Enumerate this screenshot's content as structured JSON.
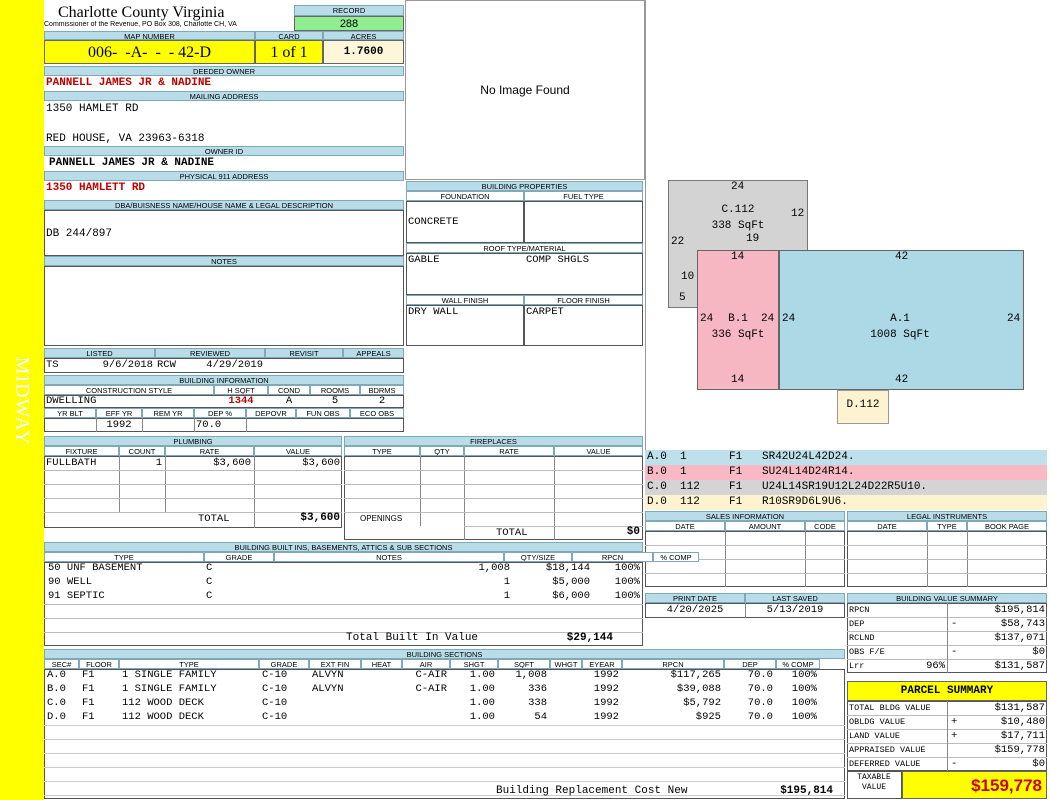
{
  "sidebar": {
    "label": "MIDWAY"
  },
  "header": {
    "county": "Charlotte County Virginia",
    "office": "Commissioner of the Revenue, PO Box 308, Charlotte CH, VA",
    "record_label": "RECORD",
    "record": "288",
    "map_label": "MAP NUMBER",
    "map": "006-  -A-  -  - 42-D",
    "card_label": "CARD",
    "card": "1 of 1",
    "acres_label": "ACRES",
    "acres": "1.7600"
  },
  "owner": {
    "deeded_label": "DEEDED OWNER",
    "deeded": "PANNELL JAMES JR & NADINE",
    "mailing_label": "MAILING ADDRESS",
    "addr1": "1350 HAMLET RD",
    "addr2": "RED HOUSE, VA 23963-6318",
    "ownerid_label": "OWNER ID",
    "ownerid": "PANNELL JAMES JR & NADINE",
    "phys_label": "PHYSICAL 911 ADDRESS",
    "phys": "1350 HAMLETT RD",
    "dba_label": "DBA/BUISNESS NAME/HOUSE NAME & LEGAL DESCRIPTION",
    "dba": "DB 244/897",
    "notes_label": "NOTES"
  },
  "photo": {
    "text": "No Image Found"
  },
  "building_properties": {
    "title": "BUILDING PROPERTIES",
    "foundation_label": "FOUNDATION",
    "fuel_label": "FUEL TYPE",
    "foundation": "CONCRETE",
    "fuel": "",
    "roof_label": "ROOF TYPE/MATERIAL",
    "roof_type": "GABLE",
    "roof_material": "COMP SHGLS",
    "wall_label": "WALL FINISH",
    "floor_label": "FLOOR FINISH",
    "wall": "DRY WALL",
    "floor": "CARPET"
  },
  "listing": {
    "listed_label": "LISTED",
    "reviewed_label": "REVIEWED",
    "revisit_label": "REVISIT",
    "appeals_label": "APPEALS",
    "listed_by": "TS",
    "listed_date": "9/6/2018",
    "reviewed_by": "RCW",
    "reviewed_date": "4/29/2019"
  },
  "building_info": {
    "title": "BUILDING INFORMATION",
    "style_label": "CONSTRUCTION STYLE",
    "hsqft_label": "H SQFT",
    "cond_label": "COND",
    "rooms_label": "ROOMS",
    "bdrms_label": "BDRMS",
    "style": "DWELLING",
    "hsqft": "1344",
    "cond": "A",
    "rooms": "5",
    "bdrms": "2",
    "yrblt_label": "YR BLT",
    "effyr_label": "EFF YR",
    "remyr_label": "REM YR",
    "dep_label": "DEP %",
    "depovr_label": "DEPOVR",
    "funobs_label": "FUN OBS",
    "ecoobs_label": "ECO OBS",
    "effyr": "1992",
    "dep": "70.0"
  },
  "plumbing": {
    "title": "PLUMBING",
    "headers": [
      "FIXTURE",
      "COUNT",
      "RATE",
      "VALUE"
    ],
    "rows": [
      {
        "fixture": "FULLBATH",
        "count": "1",
        "rate": "$3,600",
        "value": "$3,600"
      }
    ],
    "total_label": "TOTAL",
    "total": "$3,600"
  },
  "fireplaces": {
    "title": "FIREPLACES",
    "headers": [
      "TYPE",
      "QTY",
      "RATE",
      "VALUE"
    ],
    "openings_label": "OPENINGS",
    "total_label": "TOTAL",
    "total": "$0"
  },
  "sketch": {
    "areas": [
      {
        "code": "C.112",
        "sqft": "338 SqFt"
      },
      {
        "code": "B.1",
        "sqft": "336 SqFt"
      },
      {
        "code": "A.1",
        "sqft": "1008 SqFt"
      },
      {
        "code": "D.112",
        "sqft": ""
      }
    ],
    "dims": {
      "c_top": "24",
      "c_right": "12",
      "c_left": "22",
      "c_bottom": "19",
      "b_top": "14",
      "b_left": "24",
      "b_right": "24",
      "b_bottom": "14",
      "a_top": "42",
      "a_left": "24",
      "a_right": "24",
      "a_bottom": "42",
      "side10": "10",
      "side5": "5"
    }
  },
  "vectors": [
    {
      "sec": "A.0",
      "n": "1",
      "fl": "F1",
      "vec": "SR42U24L42D24.",
      "color": "#bde0ea"
    },
    {
      "sec": "B.0",
      "n": "1",
      "fl": "F1",
      "vec": "SU24L14D24R14.",
      "color": "#f8b8c4"
    },
    {
      "sec": "C.0",
      "n": "112",
      "fl": "F1",
      "vec": "U24L14SR19U12L24D22R5U10.",
      "color": "#d4d4d4"
    },
    {
      "sec": "D.0",
      "n": "112",
      "fl": "F1",
      "vec": "R10SR9D6L9U6.",
      "color": "#fdf3d0"
    }
  ],
  "sales": {
    "title": "SALES INFORMATION",
    "headers": [
      "DATE",
      "AMOUNT",
      "CODE"
    ]
  },
  "legal": {
    "title": "LEGAL INSTRUMENTS",
    "headers": [
      "DATE",
      "TYPE",
      "BOOK PAGE"
    ]
  },
  "builtins": {
    "title": "BUILDING BUILT INS, BASEMENTS, ATTICS & SUB SECTIONS",
    "headers": [
      "TYPE",
      "GRADE",
      "NOTES",
      "QTY/SIZE",
      "RPCN",
      "% COMP"
    ],
    "rows": [
      {
        "type": "50 UNF BASEMENT",
        "grade": "C",
        "notes": "",
        "qty": "1,008",
        "rpcn": "$18,144",
        "comp": "100%"
      },
      {
        "type": "90 WELL",
        "grade": "C",
        "notes": "",
        "qty": "1",
        "rpcn": "$5,000",
        "comp": "100%"
      },
      {
        "type": "91 SEPTIC",
        "grade": "C",
        "notes": "",
        "qty": "1",
        "rpcn": "$6,000",
        "comp": "100%"
      }
    ],
    "total_label": "Total Built In Value",
    "total": "$29,144"
  },
  "dates": {
    "print_label": "PRINT DATE",
    "saved_label": "LAST SAVED",
    "print": "4/20/2025",
    "saved": "5/13/2019"
  },
  "value_summary": {
    "title": "BUILDING VALUE SUMMARY",
    "rows": [
      {
        "label": "RPCN",
        "pct": "",
        "sign": "",
        "value": "$195,814"
      },
      {
        "label": "DEP",
        "pct": "",
        "sign": "-",
        "value": "$58,743"
      },
      {
        "label": "RCLND",
        "pct": "",
        "sign": "",
        "value": "$137,071"
      },
      {
        "label": "OBS F/E",
        "pct": "",
        "sign": "-",
        "value": "$0"
      },
      {
        "label": "Lrr",
        "pct": "96%",
        "sign": "",
        "value": "$131,587"
      }
    ]
  },
  "sections": {
    "title": "BUILDING SECTIONS",
    "headers": [
      "SEC#",
      "FLOOR",
      "TYPE",
      "GRADE",
      "EXT FIN",
      "HEAT",
      "AIR",
      "SHGT",
      "SQFT",
      "WHGT",
      "EYEAR",
      "RPCN",
      "DEP",
      "% COMP"
    ],
    "rows": [
      {
        "sec": "A.0",
        "floor": "F1",
        "type": "1 SINGLE FAMILY",
        "grade": "C-10",
        "ext": "ALVYN",
        "heat": "",
        "air": "C-AIR",
        "shgt": "1.00",
        "sqft": "1,008",
        "whgt": "",
        "eyear": "1992",
        "rpcn": "$117,265",
        "dep": "70.0",
        "comp": "100%"
      },
      {
        "sec": "B.0",
        "floor": "F1",
        "type": "1 SINGLE FAMILY",
        "grade": "C-10",
        "ext": "ALVYN",
        "heat": "",
        "air": "C-AIR",
        "shgt": "1.00",
        "sqft": "336",
        "whgt": "",
        "eyear": "1992",
        "rpcn": "$39,088",
        "dep": "70.0",
        "comp": "100%"
      },
      {
        "sec": "C.0",
        "floor": "F1",
        "type": "112 WOOD DECK",
        "grade": "C-10",
        "ext": "",
        "heat": "",
        "air": "",
        "shgt": "1.00",
        "sqft": "338",
        "whgt": "",
        "eyear": "1992",
        "rpcn": "$5,792",
        "dep": "70.0",
        "comp": "100%"
      },
      {
        "sec": "D.0",
        "floor": "F1",
        "type": "112 WOOD DECK",
        "grade": "C-10",
        "ext": "",
        "heat": "",
        "air": "",
        "shgt": "1.00",
        "sqft": "54",
        "whgt": "",
        "eyear": "1992",
        "rpcn": "$925",
        "dep": "70.0",
        "comp": "100%"
      }
    ],
    "total_label": "Building Replacement Cost New",
    "total": "$195,814"
  },
  "parcel_summary": {
    "title": "PARCEL SUMMARY",
    "rows": [
      {
        "label": "TOTAL BLDG VALUE",
        "sign": "",
        "value": "$131,587"
      },
      {
        "label": "OBLDG VALUE",
        "sign": "+",
        "value": "$10,480"
      },
      {
        "label": "LAND VALUE",
        "sign": "+",
        "value": "$17,711"
      },
      {
        "label": "APPRAISED VALUE",
        "sign": "",
        "value": "$159,778"
      },
      {
        "label": "DEFERRED VALUE",
        "sign": "-",
        "value": "$0"
      }
    ],
    "taxable_label": "TAXABLE VALUE",
    "taxable": "$159,778"
  }
}
